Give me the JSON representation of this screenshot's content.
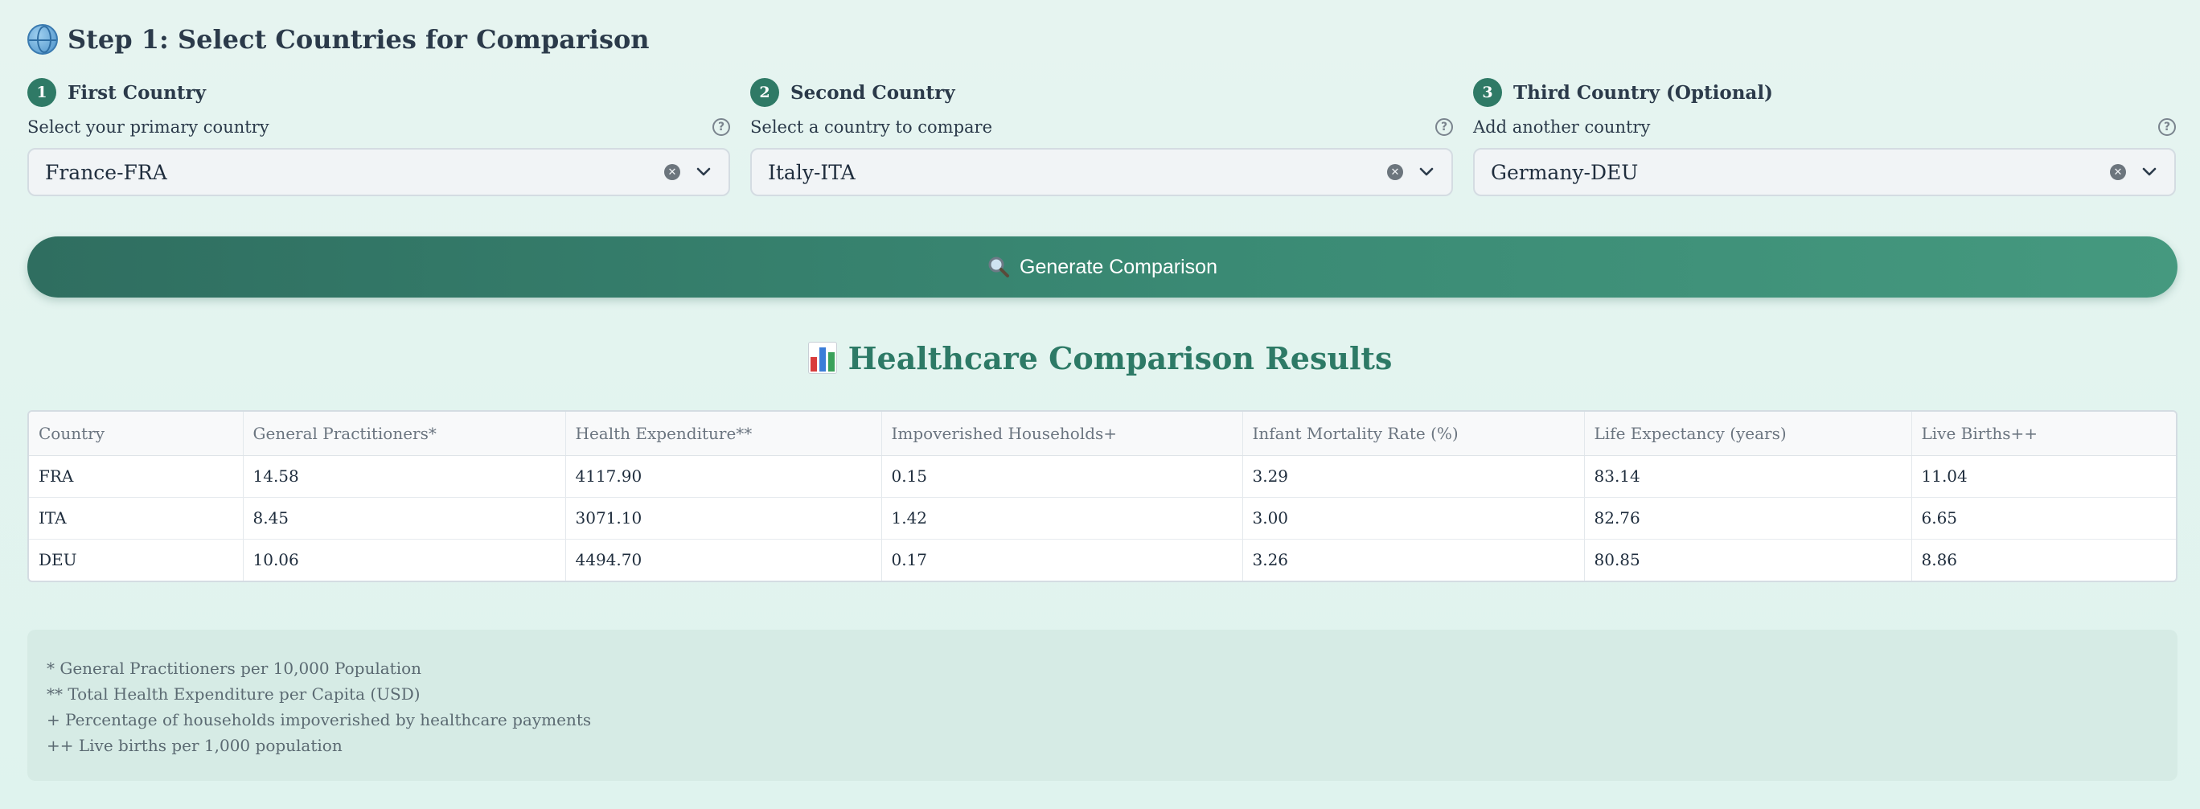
{
  "step": {
    "title": "Step 1: Select Countries for Comparison",
    "icon": "globe-icon"
  },
  "countries": [
    {
      "number": "1",
      "title": "First Country",
      "label": "Select your primary country",
      "value": "France-FRA"
    },
    {
      "number": "2",
      "title": "Second Country",
      "label": "Select a country to compare",
      "value": "Italy-ITA"
    },
    {
      "number": "3",
      "title": "Third Country (Optional)",
      "label": "Add another country",
      "value": "Germany-DEU"
    }
  ],
  "generate": {
    "label": "Generate Comparison",
    "icon": "magnifier-icon"
  },
  "results": {
    "title": "Healthcare Comparison Results",
    "icon": "bar-chart-icon"
  },
  "table": {
    "headers": [
      "Country",
      "General Practitioners*",
      "Health Expenditure**",
      "Impoverished Households+",
      "Infant Mortality Rate (%)",
      "Life Expectancy (years)",
      "Live Births++"
    ],
    "rows": [
      [
        "FRA",
        "14.58",
        "4117.90",
        "0.15",
        "3.29",
        "83.14",
        "11.04"
      ],
      [
        "ITA",
        "8.45",
        "3071.10",
        "1.42",
        "3.00",
        "82.76",
        "6.65"
      ],
      [
        "DEU",
        "10.06",
        "4494.70",
        "0.17",
        "3.26",
        "80.85",
        "8.86"
      ]
    ]
  },
  "footnotes": [
    "* General Practitioners per 10,000 Population",
    "** Total Health Expenditure per Capita (USD)",
    "+ Percentage of households impoverished by healthcare payments",
    "++ Live births per 1,000 population"
  ],
  "colors": {
    "accent": "#2f7a66",
    "heading": "#2d7a66",
    "background": "#e2f3ee"
  }
}
